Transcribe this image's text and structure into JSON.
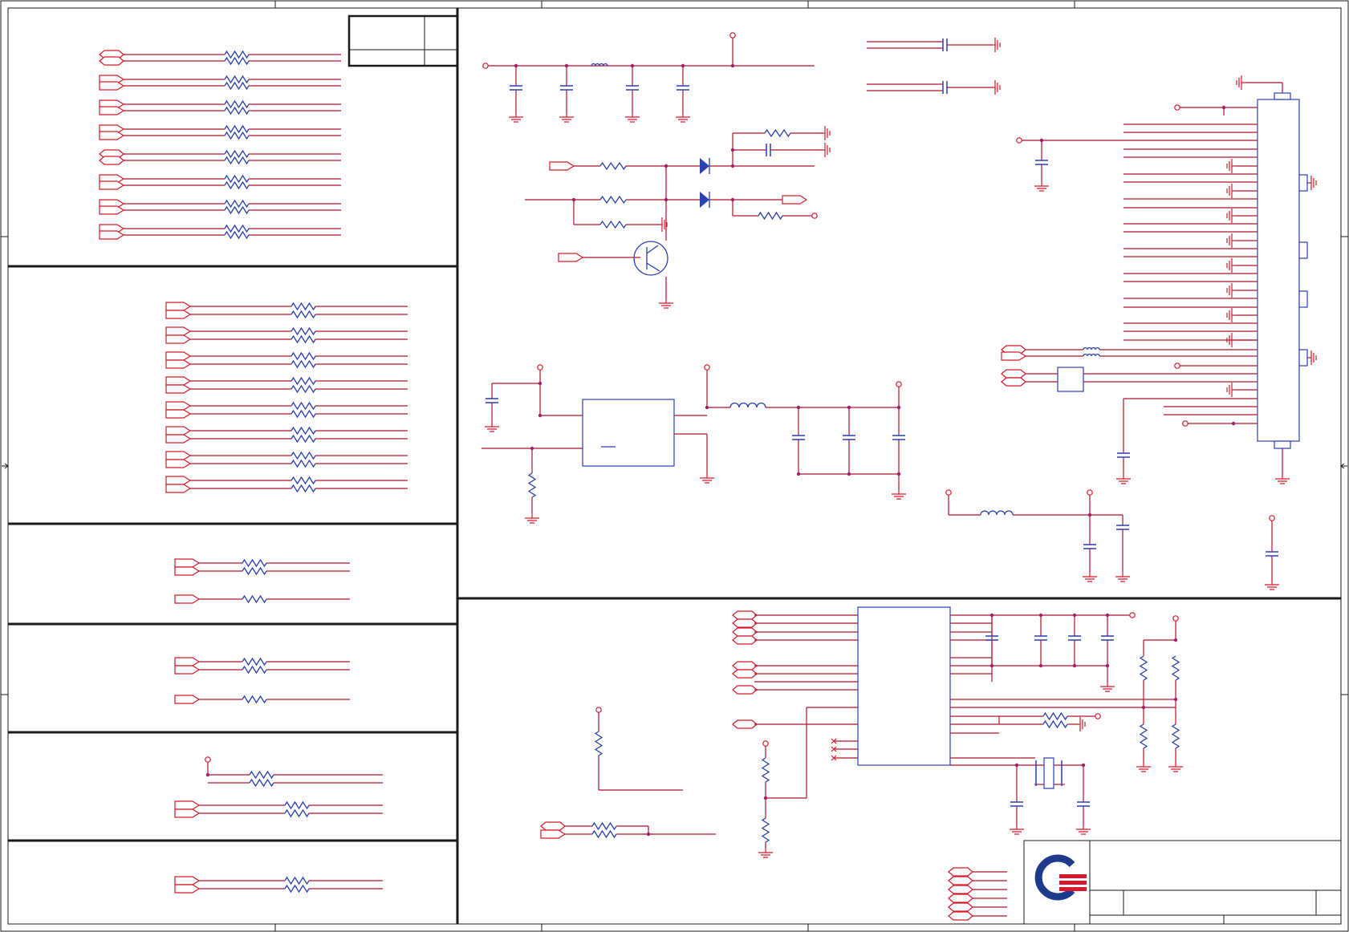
{
  "colors": {
    "wire": "#b0122a",
    "component": "#2a3fb0",
    "port": "#d6192b",
    "frame": "#1a1a1a",
    "junction": "#a0206a",
    "logo_blue": "#1d3a8c",
    "logo_red": "#d6192b"
  },
  "icons": [
    "hierarchical-port-icon",
    "resistor-icon",
    "capacitor-icon",
    "inductor-icon",
    "ground-icon",
    "diode-icon",
    "transistor-icon",
    "crystal-icon",
    "connector-icon",
    "company-logo-icon"
  ]
}
